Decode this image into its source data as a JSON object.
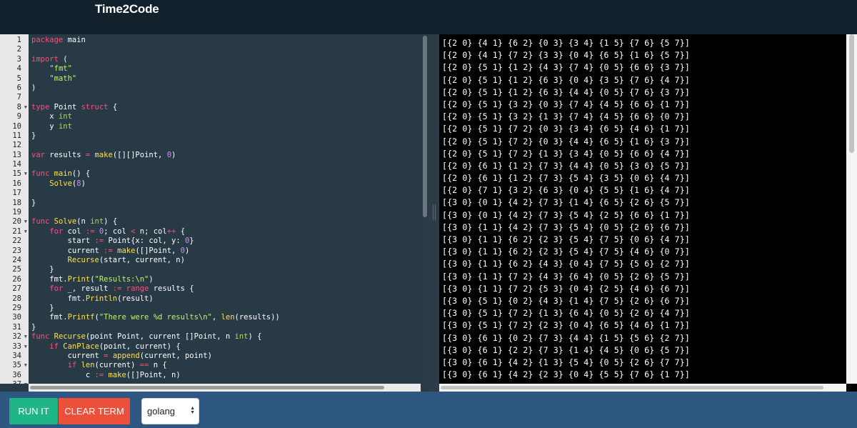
{
  "header": {
    "brand": "Time2Code"
  },
  "editor": {
    "lines": [
      [
        [
          "kw",
          "package"
        ],
        [
          "pl",
          " main"
        ]
      ],
      [],
      [
        [
          "kw",
          "import"
        ],
        [
          "pl",
          " ("
        ]
      ],
      [
        [
          "pl",
          "    "
        ],
        [
          "st",
          "\"fmt\""
        ]
      ],
      [
        [
          "pl",
          "    "
        ],
        [
          "st",
          "\"math\""
        ]
      ],
      [
        [
          "pl",
          ")"
        ]
      ],
      [],
      [
        [
          "kw",
          "type"
        ],
        [
          "pl",
          " Point "
        ],
        [
          "kw",
          "struct"
        ],
        [
          "pl",
          " {"
        ]
      ],
      [
        [
          "pl",
          "    x "
        ],
        [
          "ty",
          "int"
        ]
      ],
      [
        [
          "pl",
          "    y "
        ],
        [
          "ty",
          "int"
        ]
      ],
      [
        [
          "pl",
          "}"
        ]
      ],
      [],
      [
        [
          "kw",
          "var"
        ],
        [
          "pl",
          " results "
        ],
        [
          "op",
          "="
        ],
        [
          "pl",
          " "
        ],
        [
          "fn",
          "make"
        ],
        [
          "pl",
          "([][]Point, "
        ],
        [
          "nu",
          "0"
        ],
        [
          "pl",
          ")"
        ]
      ],
      [],
      [
        [
          "kw",
          "func"
        ],
        [
          "pl",
          " "
        ],
        [
          "fn",
          "main"
        ],
        [
          "pl",
          "() {"
        ]
      ],
      [
        [
          "pl",
          "    "
        ],
        [
          "fn",
          "Solve"
        ],
        [
          "pl",
          "("
        ],
        [
          "nu",
          "8"
        ],
        [
          "pl",
          ")"
        ]
      ],
      [],
      [
        [
          "pl",
          "}"
        ]
      ],
      [],
      [
        [
          "kw",
          "func"
        ],
        [
          "pl",
          " "
        ],
        [
          "fn",
          "Solve"
        ],
        [
          "pl",
          "(n "
        ],
        [
          "ty",
          "int"
        ],
        [
          "pl",
          ") {"
        ]
      ],
      [
        [
          "pl",
          "    "
        ],
        [
          "kw",
          "for"
        ],
        [
          "pl",
          " col "
        ],
        [
          "op",
          ":="
        ],
        [
          "pl",
          " "
        ],
        [
          "nu",
          "0"
        ],
        [
          "pl",
          "; col "
        ],
        [
          "op",
          "<"
        ],
        [
          "pl",
          " n; col"
        ],
        [
          "op",
          "++"
        ],
        [
          "pl",
          " {"
        ]
      ],
      [
        [
          "pl",
          "        start "
        ],
        [
          "op",
          ":="
        ],
        [
          "pl",
          " Point{x: col, y: "
        ],
        [
          "nu",
          "0"
        ],
        [
          "pl",
          "}"
        ]
      ],
      [
        [
          "pl",
          "        current "
        ],
        [
          "op",
          ":="
        ],
        [
          "pl",
          " "
        ],
        [
          "fn",
          "make"
        ],
        [
          "pl",
          "([]Point, "
        ],
        [
          "nu",
          "0"
        ],
        [
          "pl",
          ")"
        ]
      ],
      [
        [
          "pl",
          "        "
        ],
        [
          "fn",
          "Recurse"
        ],
        [
          "pl",
          "(start, current, n)"
        ]
      ],
      [
        [
          "pl",
          "    }"
        ]
      ],
      [
        [
          "pl",
          "    fmt."
        ],
        [
          "fn",
          "Print"
        ],
        [
          "pl",
          "("
        ],
        [
          "st",
          "\"Results:\\n\""
        ],
        [
          "pl",
          ")"
        ]
      ],
      [
        [
          "pl",
          "    "
        ],
        [
          "kw",
          "for"
        ],
        [
          "pl",
          " _, result "
        ],
        [
          "op",
          ":="
        ],
        [
          "pl",
          " "
        ],
        [
          "kw",
          "range"
        ],
        [
          "pl",
          " results {"
        ]
      ],
      [
        [
          "pl",
          "        fmt."
        ],
        [
          "fn",
          "Println"
        ],
        [
          "pl",
          "(result)"
        ]
      ],
      [
        [
          "pl",
          "    }"
        ]
      ],
      [
        [
          "pl",
          "    fmt."
        ],
        [
          "fn",
          "Printf"
        ],
        [
          "pl",
          "("
        ],
        [
          "st",
          "\"There were %d results\\n\""
        ],
        [
          "pl",
          ", "
        ],
        [
          "fn",
          "len"
        ],
        [
          "pl",
          "(results))"
        ]
      ],
      [
        [
          "pl",
          "}"
        ]
      ],
      [
        [
          "kw",
          "func"
        ],
        [
          "pl",
          " "
        ],
        [
          "fn",
          "Recurse"
        ],
        [
          "pl",
          "(point Point, current []Point, n "
        ],
        [
          "ty",
          "int"
        ],
        [
          "pl",
          ") {"
        ]
      ],
      [
        [
          "pl",
          "    "
        ],
        [
          "kw",
          "if"
        ],
        [
          "pl",
          " "
        ],
        [
          "fn",
          "CanPlace"
        ],
        [
          "pl",
          "(point, current) {"
        ]
      ],
      [
        [
          "pl",
          "        current "
        ],
        [
          "op",
          "="
        ],
        [
          "pl",
          " "
        ],
        [
          "fn",
          "append"
        ],
        [
          "pl",
          "(current, point)"
        ]
      ],
      [
        [
          "pl",
          "        "
        ],
        [
          "kw",
          "if"
        ],
        [
          "pl",
          " "
        ],
        [
          "fn",
          "len"
        ],
        [
          "pl",
          "(current) "
        ],
        [
          "op",
          "=="
        ],
        [
          "pl",
          " n {"
        ]
      ],
      [
        [
          "pl",
          "            c "
        ],
        [
          "op",
          ":="
        ],
        [
          "pl",
          " "
        ],
        [
          "fn",
          "make"
        ],
        [
          "pl",
          "([]Point, n)"
        ]
      ],
      [
        [
          "pl",
          ""
        ]
      ]
    ],
    "folds": [
      8,
      15,
      20,
      21,
      32,
      33,
      35,
      37
    ]
  },
  "terminal": {
    "lines": [
      "[{2 0} {4 1} {6 2} {0 3} {3 4} {1 5} {7 6} {5 7}]",
      "[{2 0} {4 1} {7 2} {3 3} {0 4} {6 5} {1 6} {5 7}]",
      "[{2 0} {5 1} {1 2} {4 3} {7 4} {0 5} {6 6} {3 7}]",
      "[{2 0} {5 1} {1 2} {6 3} {0 4} {3 5} {7 6} {4 7}]",
      "[{2 0} {5 1} {1 2} {6 3} {4 4} {0 5} {7 6} {3 7}]",
      "[{2 0} {5 1} {3 2} {0 3} {7 4} {4 5} {6 6} {1 7}]",
      "[{2 0} {5 1} {3 2} {1 3} {7 4} {4 5} {6 6} {0 7}]",
      "[{2 0} {5 1} {7 2} {0 3} {3 4} {6 5} {4 6} {1 7}]",
      "[{2 0} {5 1} {7 2} {0 3} {4 4} {6 5} {1 6} {3 7}]",
      "[{2 0} {5 1} {7 2} {1 3} {3 4} {0 5} {6 6} {4 7}]",
      "[{2 0} {6 1} {1 2} {7 3} {4 4} {0 5} {3 6} {5 7}]",
      "[{2 0} {6 1} {1 2} {7 3} {5 4} {3 5} {0 6} {4 7}]",
      "[{2 0} {7 1} {3 2} {6 3} {0 4} {5 5} {1 6} {4 7}]",
      "[{3 0} {0 1} {4 2} {7 3} {1 4} {6 5} {2 6} {5 7}]",
      "[{3 0} {0 1} {4 2} {7 3} {5 4} {2 5} {6 6} {1 7}]",
      "[{3 0} {1 1} {4 2} {7 3} {5 4} {0 5} {2 6} {6 7}]",
      "[{3 0} {1 1} {6 2} {2 3} {5 4} {7 5} {0 6} {4 7}]",
      "[{3 0} {1 1} {6 2} {2 3} {5 4} {7 5} {4 6} {0 7}]",
      "[{3 0} {1 1} {6 2} {4 3} {0 4} {7 5} {5 6} {2 7}]",
      "[{3 0} {1 1} {7 2} {4 3} {6 4} {0 5} {2 6} {5 7}]",
      "[{3 0} {1 1} {7 2} {5 3} {0 4} {2 5} {4 6} {6 7}]",
      "[{3 0} {5 1} {0 2} {4 3} {1 4} {7 5} {2 6} {6 7}]",
      "[{3 0} {5 1} {7 2} {1 3} {6 4} {0 5} {2 6} {4 7}]",
      "[{3 0} {5 1} {7 2} {2 3} {0 4} {6 5} {4 6} {1 7}]",
      "[{3 0} {6 1} {0 2} {7 3} {4 4} {1 5} {5 6} {2 7}]",
      "[{3 0} {6 1} {2 2} {7 3} {1 4} {4 5} {0 6} {5 7}]",
      "[{3 0} {6 1} {4 2} {1 3} {5 4} {0 5} {2 6} {7 7}]",
      "[{3 0} {6 1} {4 2} {2 3} {0 4} {5 5} {7 6} {1 7}]"
    ]
  },
  "toolbar": {
    "run_label": "RUN IT",
    "clear_label": "CLEAR TERM",
    "language": "golang"
  },
  "colors": {
    "header_bg": "#12212c",
    "editor_bg": "#283a46",
    "run_button": "#1fb587",
    "clear_button": "#ec4f3a",
    "bottom_bar": "#2e5781",
    "keyword": "#ff4d7e",
    "type": "#a6e22e",
    "function": "#ffe14a",
    "string": "#c1f566",
    "number": "#c792ea"
  },
  "icons": {
    "fold": "fold-arrow-icon",
    "select": "select-arrows-icon",
    "splitter": "splitter-grip-icon"
  }
}
